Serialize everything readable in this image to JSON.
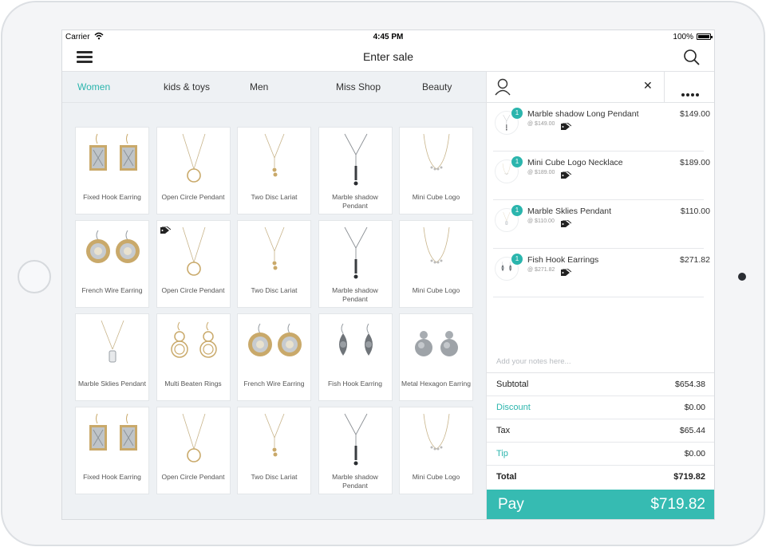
{
  "status_bar": {
    "carrier": "Carrier",
    "time": "4:45 PM",
    "battery": "100%"
  },
  "nav": {
    "title": "Enter sale"
  },
  "categories": [
    {
      "label": "Women",
      "active": true
    },
    {
      "label": "kids & toys",
      "active": false
    },
    {
      "label": "Men",
      "active": false
    },
    {
      "label": "Miss Shop",
      "active": false
    },
    {
      "label": "Beauty",
      "active": false
    }
  ],
  "products": [
    {
      "name": "Fixed Hook Earring",
      "img": "earring-rect"
    },
    {
      "name": "Open Circle Pendant",
      "img": "necklace-circle"
    },
    {
      "name": "Two Disc Lariat",
      "img": "necklace-lariat"
    },
    {
      "name": "Marble shadow Pendant",
      "img": "necklace-y"
    },
    {
      "name": "Mini Cube Logo",
      "img": "necklace-cube"
    },
    {
      "name": "French Wire Earring",
      "img": "earring-disc"
    },
    {
      "name": "Open Circle Pendant",
      "img": "necklace-circle",
      "tagged": true
    },
    {
      "name": "Two Disc Lariat",
      "img": "necklace-lariat"
    },
    {
      "name": "Marble shadow Pendant",
      "img": "necklace-y"
    },
    {
      "name": "Mini Cube Logo",
      "img": "necklace-cube"
    },
    {
      "name": "Marble Sklies Pendant",
      "img": "necklace-bar"
    },
    {
      "name": "Multi Beaten Rings",
      "img": "earring-rings"
    },
    {
      "name": "French Wire Earring",
      "img": "earring-disc"
    },
    {
      "name": "Fish Hook Earring",
      "img": "earring-drop"
    },
    {
      "name": "Metal Hexagon Earring",
      "img": "earring-hex"
    },
    {
      "name": "Fixed Hook Earring",
      "img": "earring-rect"
    },
    {
      "name": "Open Circle Pendant",
      "img": "necklace-circle"
    },
    {
      "name": "Two Disc Lariat",
      "img": "necklace-lariat"
    },
    {
      "name": "Marble shadow Pendant",
      "img": "necklace-y"
    },
    {
      "name": "Mini Cube Logo",
      "img": "necklace-cube"
    }
  ],
  "cart": {
    "lines": [
      {
        "qty": "1",
        "name": "Marble shadow Long Pendant",
        "unit": "@ $149.00",
        "price": "$149.00"
      },
      {
        "qty": "1",
        "name": "Mini Cube Logo Necklace",
        "unit": "@ $189.00",
        "price": "$189.00"
      },
      {
        "qty": "1",
        "name": "Marble Sklies Pendant",
        "unit": "@ $110.00",
        "price": "$110.00"
      },
      {
        "qty": "1",
        "name": "Fish Hook Earrings",
        "unit": "@ $271.82",
        "price": "$271.82"
      }
    ],
    "notes_placeholder": "Add your notes here...",
    "subtotal_label": "Subtotal",
    "subtotal": "$654.38",
    "discount_label": "Discount",
    "discount": "$0.00",
    "tax_label": "Tax",
    "tax": "$65.44",
    "tip_label": "Tip",
    "tip": "$0.00",
    "total_label": "Total",
    "total": "$719.82",
    "pay_label": "Pay",
    "pay_amount": "$719.82"
  },
  "colors": {
    "accent": "#2bb5ad",
    "pay_bg": "#36bbb2",
    "pane_bg": "#eef1f4"
  }
}
